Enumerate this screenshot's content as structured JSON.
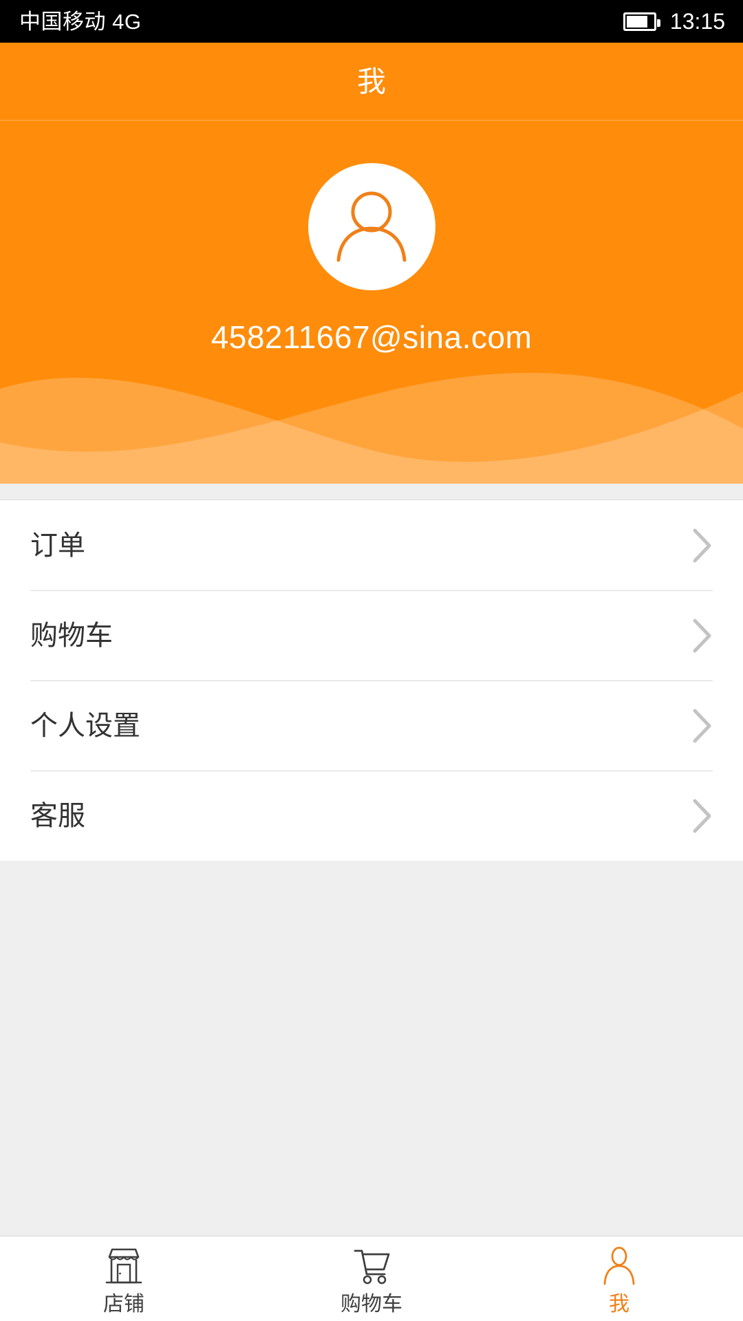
{
  "status_bar": {
    "carrier": "中国移动 4G",
    "time": "13:15",
    "battery_icon": "battery-icon",
    "battery_level_pct": 72
  },
  "header": {
    "title": "我"
  },
  "profile": {
    "avatar_icon": "user-avatar-icon",
    "email": "458211667@sina.com",
    "background_color": "#ff8c0a",
    "wave_color": "#ffab4d"
  },
  "menu": {
    "items": [
      {
        "label": "订单",
        "chevron_icon": "chevron-right-icon"
      },
      {
        "label": "购物车",
        "chevron_icon": "chevron-right-icon"
      },
      {
        "label": "个人设置",
        "chevron_icon": "chevron-right-icon"
      },
      {
        "label": "客服",
        "chevron_icon": "chevron-right-icon"
      }
    ]
  },
  "tabbar": {
    "active_color": "#f08019",
    "inactive_color": "#3f3f3f",
    "tabs": [
      {
        "label": "店铺",
        "icon": "store-icon",
        "active": false
      },
      {
        "label": "购物车",
        "icon": "cart-icon",
        "active": false
      },
      {
        "label": "我",
        "icon": "person-icon",
        "active": true
      }
    ]
  }
}
